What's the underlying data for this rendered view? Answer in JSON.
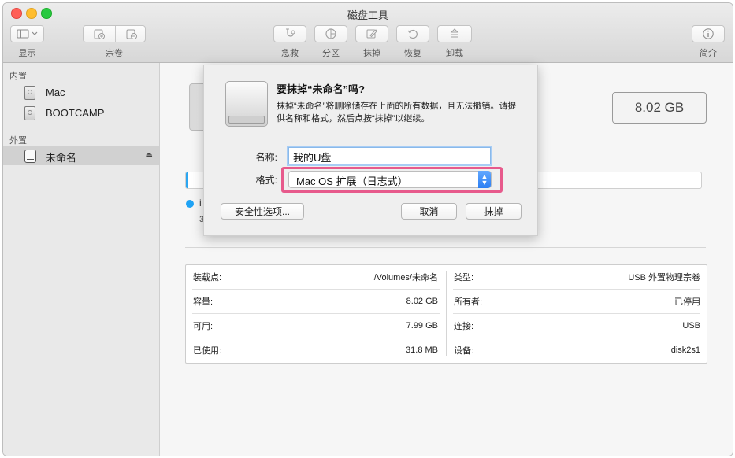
{
  "window": {
    "title": "磁盘工具"
  },
  "toolbar": {
    "display_label": "显示",
    "volume_label": "宗卷",
    "first_aid_label": "急救",
    "partition_label": "分区",
    "erase_label": "抹掉",
    "restore_label": "恢复",
    "unmount_label": "卸载",
    "info_label": "简介"
  },
  "sidebar": {
    "internal_header": "内置",
    "external_header": "外置",
    "internal_items": [
      {
        "label": "Mac"
      },
      {
        "label": "BOOTCAMP"
      }
    ],
    "external_items": [
      {
        "label": "未命名",
        "selected": true
      }
    ]
  },
  "main": {
    "capacity": "8.02 GB",
    "usage_fraction": 0.004,
    "usage_legend_partial": "i",
    "usage_sub_partial": "3",
    "info_left": [
      {
        "key": "装载点:",
        "value": "/Volumes/未命名"
      },
      {
        "key": "容量:",
        "value": "8.02 GB"
      },
      {
        "key": "可用:",
        "value": "7.99 GB"
      },
      {
        "key": "已使用:",
        "value": "31.8 MB"
      }
    ],
    "info_right": [
      {
        "key": "类型:",
        "value": "USB 外置物理宗卷"
      },
      {
        "key": "所有者:",
        "value": "已停用"
      },
      {
        "key": "连接:",
        "value": "USB"
      },
      {
        "key": "设备:",
        "value": "disk2s1"
      }
    ]
  },
  "dialog": {
    "title": "要抹掉“未命名”吗?",
    "message": "抹掉“未命名”将删除储存在上面的所有数据，且无法撤销。请提供名称和格式，然后点按“抹掉”以继续。",
    "name_label": "名称:",
    "name_value": "我的U盘",
    "format_label": "格式:",
    "format_value": "Mac OS 扩展（日志式）",
    "security_button": "安全性选项...",
    "cancel_button": "取消",
    "erase_button": "抹掉",
    "highlight_color": "#e75a8c"
  },
  "colors": {
    "accent": "#2b7ef3",
    "usage": "#1fa3f5"
  }
}
